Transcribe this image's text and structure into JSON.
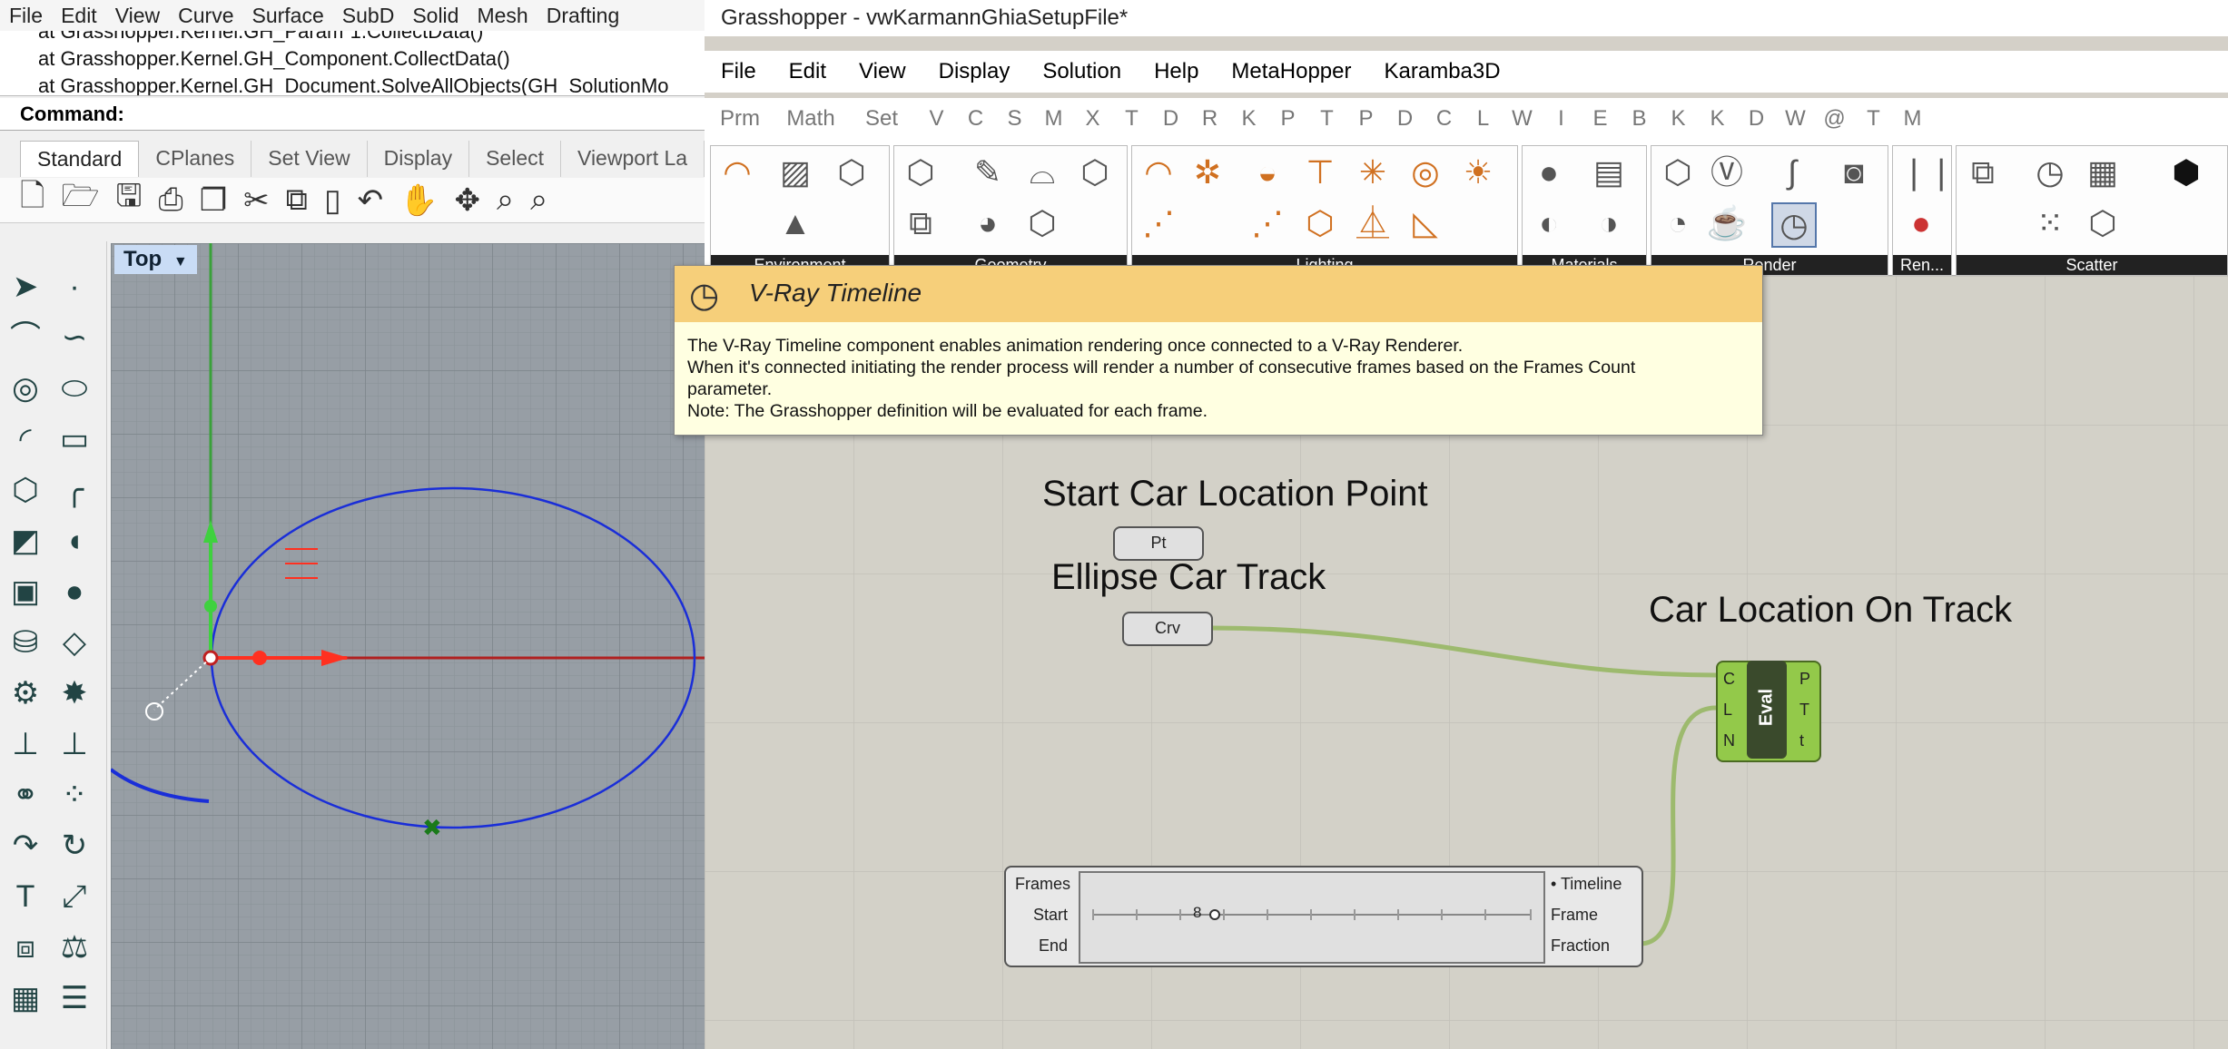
{
  "rhino": {
    "menu": [
      "File",
      "Edit",
      "View",
      "Curve",
      "Surface",
      "SubD",
      "Solid",
      "Mesh",
      "Drafting"
    ],
    "command_lines": [
      "at Grasshopper.Kernel.GH_Param`1.CollectData()",
      "at Grasshopper.Kernel.GH_Component.CollectData()",
      "at Grasshopper.Kernel.GH_Document.SolveAllObjects(GH_SolutionMo"
    ],
    "command_prompt": "Command:",
    "tabs": [
      "Standard",
      "CPlanes",
      "Set View",
      "Display",
      "Select",
      "Viewport La"
    ],
    "viewport_label": "Top"
  },
  "gh": {
    "title": "Grasshopper - vwKarmannGhiaSetupFile*",
    "menu": [
      "File",
      "Edit",
      "View",
      "Display",
      "Solution",
      "Help",
      "MetaHopper",
      "Karamba3D"
    ],
    "tabs": [
      "Prm",
      "Math",
      "Set",
      "V",
      "C",
      "S",
      "M",
      "X",
      "T",
      "D",
      "R",
      "K",
      "P",
      "T",
      "P",
      "D",
      "C",
      "L",
      "W",
      "I",
      "E",
      "B",
      "K",
      "K",
      "D",
      "W",
      "@",
      "T",
      "M"
    ],
    "panels": [
      "Environment",
      "Geometry",
      "Lighting",
      "Materials",
      "Render",
      "Ren...",
      "Scatter"
    ],
    "tooltip": {
      "title": "V-Ray Timeline",
      "lines": [
        "The V-Ray Timeline component enables animation rendering once connected to a V-Ray Renderer.",
        "When it's connected initiating the render process will render a number of consecutive frames based on the Frames Count",
        "parameter.",
        "Note: The Grasshopper definition will be evaluated for each frame."
      ]
    },
    "canvas": {
      "start_label": "Start Car Location Point",
      "pt_label": "Pt",
      "ellipse_label": "Ellipse Car Track",
      "crv_label": "Crv",
      "track_label": "Car Location On Track",
      "eval": {
        "name": "Eval",
        "inputs": [
          "C",
          "L",
          "N"
        ],
        "outputs": [
          "P",
          "T",
          "t"
        ]
      },
      "timeline": {
        "inputs": [
          "Frames",
          "Start",
          "End"
        ],
        "outputs": [
          "• Timeline",
          "Frame",
          "Fraction"
        ],
        "value": "8"
      }
    }
  }
}
